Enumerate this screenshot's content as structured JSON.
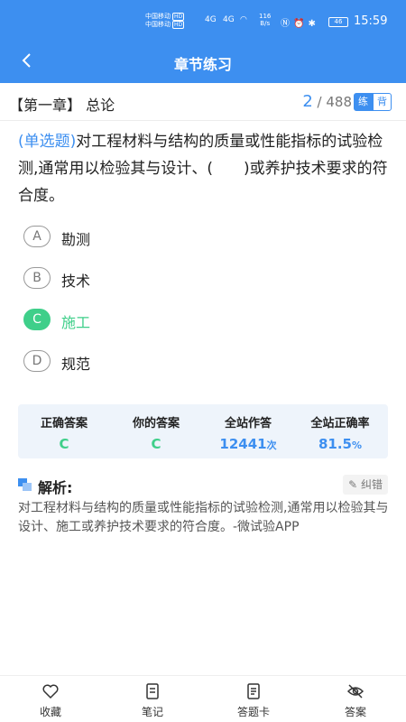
{
  "status_bar": {
    "carrier_1": "中国移动",
    "carrier_2": "中国移动",
    "hd_1": "HD",
    "hd_2": "HD",
    "sig_1": "4G",
    "sig_2": "4G",
    "speed_value": "116",
    "speed_unit": "B/s",
    "battery": "46",
    "time": "15:59"
  },
  "header": {
    "title": "章节练习"
  },
  "chapter": {
    "name": "【第一章】 总论",
    "current": "2",
    "total": "/ 488",
    "mode_practice": "练",
    "mode_recite": "背"
  },
  "question": {
    "type": "(单选题)",
    "text": "对工程材料与结构的质量或性能指标的试验检测,通常用以检验其与设计、(　　)或养护技术要求的符合度。"
  },
  "options": [
    {
      "letter": "A",
      "text": "勘测"
    },
    {
      "letter": "B",
      "text": "技术"
    },
    {
      "letter": "C",
      "text": "施工",
      "correct": true
    },
    {
      "letter": "D",
      "text": "规范"
    }
  ],
  "stats": {
    "correct_label": "正确答案",
    "correct_value": "C",
    "mine_label": "你的答案",
    "mine_value": "C",
    "count_label": "全站作答",
    "count_value": "12441",
    "count_unit": "次",
    "rate_label": "全站正确率",
    "rate_value": "81.5",
    "rate_unit": "%"
  },
  "analysis": {
    "title": "解析:",
    "report": "纠错",
    "body": "对工程材料与结构的质量或性能指标的试验检测,通常用以检验其与设计、施工或养护技术要求的符合度。-微试验APP"
  },
  "bottom_tabs": {
    "favorite": "收藏",
    "notes": "笔记",
    "answer_card": "答题卡",
    "answer": "答案"
  },
  "colors": {
    "primary": "#3d8ff0",
    "correct": "#3fcf8a"
  }
}
